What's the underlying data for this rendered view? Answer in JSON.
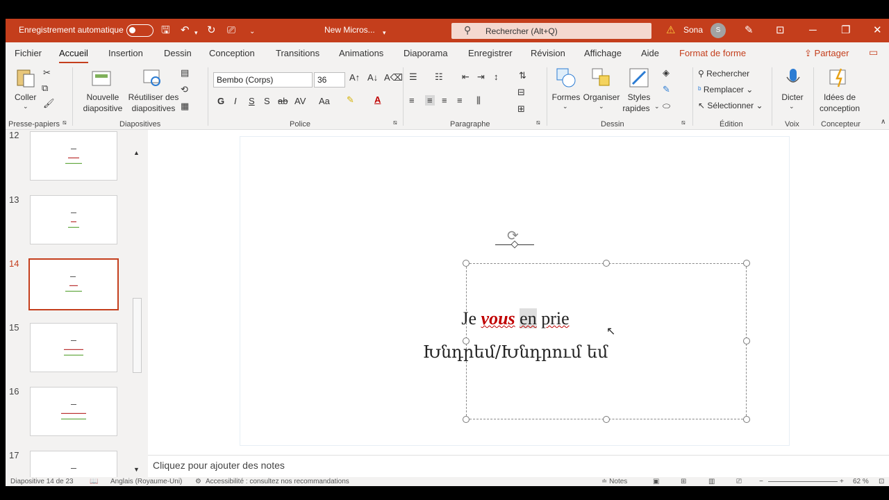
{
  "titlebar": {
    "autosave_label": "Enregistrement automatique",
    "document_title": "New Micros...",
    "search_placeholder": "Rechercher (Alt+Q)",
    "user_name": "Sona",
    "avatar_initial": "S",
    "accent_color": "#c43e1c"
  },
  "menu": {
    "tabs": [
      "Fichier",
      "Accueil",
      "Insertion",
      "Dessin",
      "Conception",
      "Transitions",
      "Animations",
      "Diaporama",
      "Enregistrer",
      "Révision",
      "Affichage",
      "Aide",
      "Format de forme"
    ],
    "active_tab": "Accueil",
    "share_label": "Partager"
  },
  "ribbon": {
    "clipboard": {
      "paste_label": "Coller",
      "group_label": "Presse-papiers"
    },
    "slides": {
      "new_slide_l1": "Nouvelle",
      "new_slide_l2": "diapositive",
      "reuse_l1": "Réutiliser des",
      "reuse_l2": "diapositives",
      "group_label": "Diapositives"
    },
    "font": {
      "font_name": "Bembo (Corps)",
      "font_size": "36",
      "bold": "G",
      "italic": "I",
      "underline": "S",
      "shadow": "S",
      "group_label": "Police"
    },
    "paragraph": {
      "group_label": "Paragraphe"
    },
    "drawing": {
      "shapes_label": "Formes",
      "arrange_label": "Organiser",
      "styles_l1": "Styles",
      "styles_l2": "rapides",
      "group_label": "Dessin"
    },
    "editing": {
      "find_label": "Rechercher",
      "replace_label": "Remplacer",
      "select_label": "Sélectionner",
      "group_label": "Édition"
    },
    "voice": {
      "dictate_label": "Dicter",
      "group_label": "Voix"
    },
    "designer": {
      "ideas_l1": "Idées de",
      "ideas_l2": "conception",
      "group_label": "Concepteur"
    }
  },
  "thumbnails": [
    {
      "number": "12",
      "selected": false
    },
    {
      "number": "13",
      "selected": false
    },
    {
      "number": "14",
      "selected": true
    },
    {
      "number": "15",
      "selected": false
    },
    {
      "number": "16",
      "selected": false
    },
    {
      "number": "17",
      "selected": false
    }
  ],
  "slide": {
    "word_je": "Je",
    "word_vous": "vous",
    "word_en": "en",
    "word_prie": "prie",
    "armenian_line": "Խնդրեմ/Խնդրում եմ"
  },
  "notes_placeholder": "Cliquez pour ajouter des notes",
  "status": {
    "slide_counter": "Diapositive 14 de 23",
    "language": "Anglais (Royaume-Uni)",
    "accessibility": "Accessibilité : consultez nos recommandations",
    "notes_label": "Notes",
    "zoom": "62 %"
  }
}
